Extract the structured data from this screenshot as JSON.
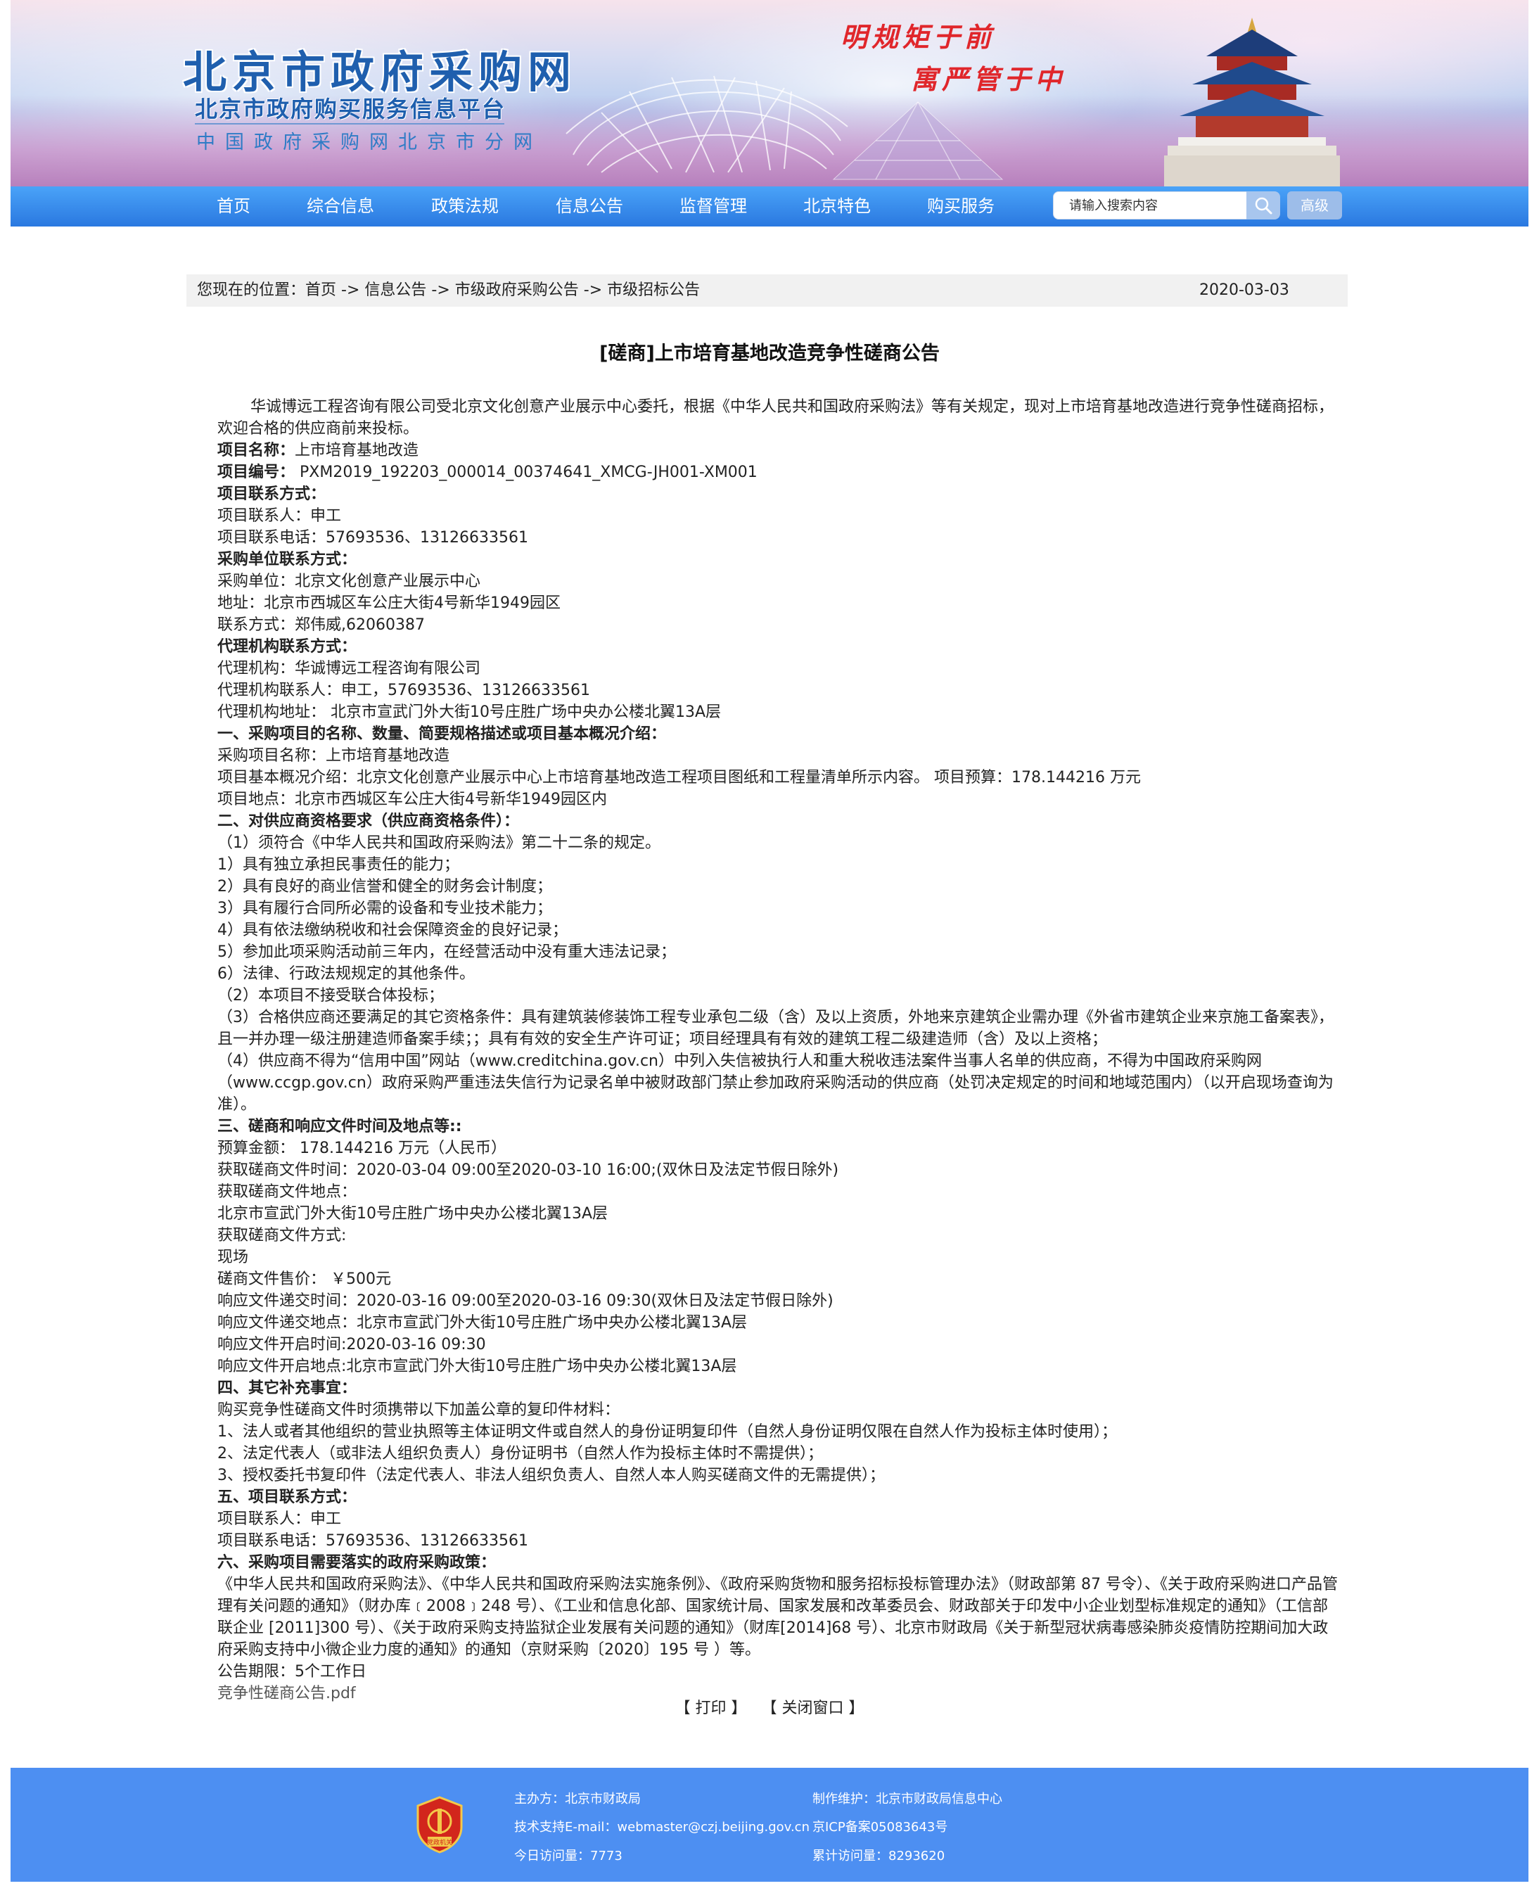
{
  "banner": {
    "site_name": "北京市政府采购网",
    "platform": "北京市政府购买服务信息平台",
    "subsite": "中国政府采购网北京市分网",
    "slogan1": "明规矩于前",
    "slogan2": "寓严管于中"
  },
  "nav": {
    "items": [
      "首页",
      "综合信息",
      "政策法规",
      "信息公告",
      "监督管理",
      "北京特色",
      "购买服务"
    ],
    "search_placeholder": "请输入搜索内容",
    "advanced_label": "高级"
  },
  "breadcrumb": {
    "prefix": "您现在的位置：",
    "items": [
      "首页",
      "信息公告",
      "市级政府采购公告",
      "市级招标公告"
    ],
    "separator": " -> ",
    "date": "2020-03-03"
  },
  "article": {
    "title": "[磋商]上市培育基地改造竞争性磋商公告",
    "intro": "华诚博远工程咨询有限公司受北京文化创意产业展示中心委托，根据《中华人民共和国政府采购法》等有关规定，现对上市培育基地改造进行竞争性磋商招标，欢迎合格的供应商前来投标。",
    "lines": [
      {
        "label": "项目名称：",
        "text": "上市培育基地改造"
      },
      {
        "label": "项目编号：",
        "text": " PXM2019_192203_000014_00374641_XMCG-JH001-XM001"
      },
      {
        "label": "项目联系方式：",
        "text": ""
      },
      {
        "label": "",
        "text": "项目联系人：申工"
      },
      {
        "label": "",
        "text": "项目联系电话：57693536、13126633561"
      },
      {
        "label": "采购单位联系方式：",
        "text": ""
      },
      {
        "label": "",
        "text": "采购单位：北京文化创意产业展示中心"
      },
      {
        "label": "",
        "text": "地址：北京市西城区车公庄大街4号新华1949园区"
      },
      {
        "label": "",
        "text": "联系方式：郑伟威,62060387"
      },
      {
        "label": "代理机构联系方式：",
        "text": ""
      },
      {
        "label": "",
        "text": "代理机构：华诚博远工程咨询有限公司"
      },
      {
        "label": "",
        "text": "代理机构联系人：申工，57693536、13126633561"
      },
      {
        "label": "",
        "text": "代理机构地址： 北京市宣武门外大街10号庄胜广场中央办公楼北翼13A层"
      },
      {
        "label": "一、采购项目的名称、数量、简要规格描述或项目基本概况介绍：",
        "text": ""
      },
      {
        "label": "",
        "text": "采购项目名称：上市培育基地改造"
      },
      {
        "label": "",
        "text": "项目基本概况介绍：北京文化创意产业展示中心上市培育基地改造工程项目图纸和工程量清单所示内容。 项目预算：178.144216 万元"
      },
      {
        "label": "",
        "text": "项目地点：北京市西城区车公庄大街4号新华1949园区内"
      },
      {
        "label": "二、对供应商资格要求（供应商资格条件）：",
        "text": ""
      },
      {
        "label": "",
        "text": "（1）须符合《中华人民共和国政府采购法》第二十二条的规定。"
      },
      {
        "label": "",
        "text": "1）具有独立承担民事责任的能力；"
      },
      {
        "label": "",
        "text": "2）具有良好的商业信誉和健全的财务会计制度；"
      },
      {
        "label": "",
        "text": "3）具有履行合同所必需的设备和专业技术能力；"
      },
      {
        "label": "",
        "text": "4）具有依法缴纳税收和社会保障资金的良好记录；"
      },
      {
        "label": "",
        "text": "5）参加此项采购活动前三年内，在经营活动中没有重大违法记录；"
      },
      {
        "label": "",
        "text": "6）法律、行政法规规定的其他条件。"
      },
      {
        "label": "",
        "text": "（2）本项目不接受联合体投标；"
      },
      {
        "label": "",
        "text": "（3）合格供应商还要满足的其它资格条件：具有建筑装修装饰工程专业承包二级（含）及以上资质，外地来京建筑企业需办理《外省市建筑企业来京施工备案表》，且一并办理一级注册建造师备案手续；；具有有效的安全生产许可证；项目经理具有有效的建筑工程二级建造师（含）及以上资格；"
      },
      {
        "label": "",
        "text": "（4）供应商不得为“信用中国”网站（www.creditchina.gov.cn）中列入失信被执行人和重大税收违法案件当事人名单的供应商，不得为中国政府采购网（www.ccgp.gov.cn）政府采购严重违法失信行为记录名单中被财政部门禁止参加政府采购活动的供应商（处罚决定规定的时间和地域范围内）（以开启现场查询为准）。"
      },
      {
        "label": "三、磋商和响应文件时间及地点等::",
        "text": ""
      },
      {
        "label": "",
        "text": "预算金额： 178.144216 万元（人民币）"
      },
      {
        "label": "",
        "text": "获取磋商文件时间：2020-03-04 09:00至2020-03-10 16:00;(双休日及法定节假日除外)"
      },
      {
        "label": "",
        "text": "获取磋商文件地点："
      },
      {
        "label": "",
        "text": "北京市宣武门外大街10号庄胜广场中央办公楼北翼13A层"
      },
      {
        "label": "",
        "text": "获取磋商文件方式:"
      },
      {
        "label": "",
        "text": "现场"
      },
      {
        "label": "",
        "text": "磋商文件售价： ￥500元"
      },
      {
        "label": "",
        "text": "响应文件递交时间：2020-03-16 09:00至2020-03-16 09:30(双休日及法定节假日除外)"
      },
      {
        "label": "",
        "text": "响应文件递交地点：北京市宣武门外大街10号庄胜广场中央办公楼北翼13A层"
      },
      {
        "label": "",
        "text": "响应文件开启时间:2020-03-16 09:30"
      },
      {
        "label": "",
        "text": "响应文件开启地点:北京市宣武门外大街10号庄胜广场中央办公楼北翼13A层"
      },
      {
        "label": "四、其它补充事宜：",
        "text": ""
      },
      {
        "label": "",
        "text": "购买竞争性磋商文件时须携带以下加盖公章的复印件材料："
      },
      {
        "label": "",
        "text": "1、法人或者其他组织的营业执照等主体证明文件或自然人的身份证明复印件（自然人身份证明仅限在自然人作为投标主体时使用）；"
      },
      {
        "label": "",
        "text": "2、法定代表人（或非法人组织负责人）身份证明书（自然人作为投标主体时不需提供）；"
      },
      {
        "label": "",
        "text": "3、授权委托书复印件（法定代表人、非法人组织负责人、自然人本人购买磋商文件的无需提供）；"
      },
      {
        "label": "五、项目联系方式：",
        "text": ""
      },
      {
        "label": "",
        "text": "项目联系人：申工"
      },
      {
        "label": "",
        "text": "项目联系电话：57693536、13126633561"
      },
      {
        "label": "六、采购项目需要落实的政府采购政策：",
        "text": ""
      },
      {
        "label": "",
        "text": "《中华人民共和国政府采购法》、《中华人民共和国政府采购法实施条例》、《政府采购货物和服务招标投标管理办法》（财政部第 87 号令）、《关于政府采购进口产品管理有关问题的通知》（财办库﹝2008﹞248 号）、《工业和信息化部、国家统计局、国家发展和改革委员会、财政部关于印发中小企业划型标准规定的通知》（工信部联企业 [2011]300 号）、《关于政府采购支持监狱企业发展有关问题的通知》（财库[2014]68 号）、北京市财政局《关于新型冠状病毒感染肺炎疫情防控期间加大政府采购支持中小微企业力度的通知》的通知（京财采购〔2020〕195 号 ）等。"
      },
      {
        "label": "",
        "text": "公告期限：5个工作日"
      }
    ],
    "attachment": "竞争性磋商公告.pdf",
    "print_label": "【 打印 】",
    "close_label": "【 关闭窗口 】"
  },
  "footer": {
    "sponsor": "主办方：北京市财政局",
    "maintainer": "制作维护：北京市财政局信息中心",
    "support": "技术支持E-mail：webmaster@czj.beijing.gov.cn",
    "icp": "京ICP备案05083643号",
    "today_visits": "今日访问量：7773",
    "total_visits": "累计访问量：8293620",
    "emblem_text": "党政机关"
  },
  "colors": {
    "nav_blue": "#2a78e0",
    "footer_blue": "#4d8ff2",
    "logo_blue": "#1f5fae",
    "slogan_red": "#e0262b"
  }
}
